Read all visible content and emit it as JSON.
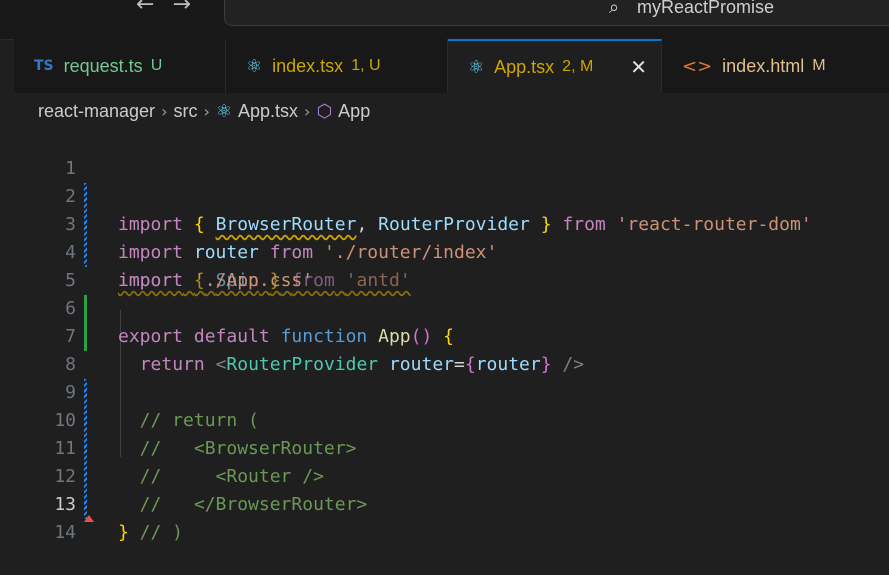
{
  "title_bar": {
    "back_icon": "arrow-left-icon",
    "forward_icon": "arrow-right-icon",
    "search_icon": "search-icon",
    "window_title": "myReactPromise"
  },
  "tabs": [
    {
      "label": "request.ts",
      "status": "U",
      "icon": "ts",
      "color": "#73c991",
      "active": false
    },
    {
      "label": "index.tsx",
      "status": "1, U",
      "icon": "react-icon",
      "color": "#cca700",
      "active": false
    },
    {
      "label": "App.tsx",
      "status": "2, M",
      "icon": "react-icon",
      "color": "#cca700",
      "active": true
    },
    {
      "label": "index.html",
      "status": "M",
      "icon": "html-icon",
      "color": "#e2c08d",
      "active": false
    }
  ],
  "breadcrumb": {
    "items": [
      "react-manager",
      "src",
      "App.tsx",
      "App"
    ]
  },
  "editor": {
    "line_numbers": [
      "1",
      "2",
      "3",
      "4",
      "5",
      "6",
      "7",
      "8",
      "9",
      "10",
      "11",
      "12",
      "13",
      "14"
    ],
    "current_line": "13",
    "tokens": {
      "l1": [
        "import",
        " ",
        "{",
        " ",
        "BrowserRouter",
        ", ",
        "RouterProvider",
        " ",
        "}",
        " ",
        "from",
        " ",
        "'react-router-dom'"
      ],
      "l2": [
        "import",
        " ",
        "router",
        " ",
        "from",
        " ",
        "'./router/index'"
      ],
      "l3": [
        "import",
        " ",
        "{",
        " ",
        "Spin",
        " ",
        "}",
        " ",
        "from",
        " ",
        "'antd'"
      ],
      "l4": [
        "import",
        " ",
        "'./App.css'"
      ],
      "l5": [
        "export",
        " ",
        "default",
        " ",
        "function",
        " ",
        "App",
        "()",
        " ",
        "{"
      ],
      "l6": [
        "  ",
        "return",
        " ",
        "<",
        "RouterProvider",
        " ",
        "router",
        "=",
        "{",
        "router",
        "}",
        " ",
        "/>"
      ],
      "l8": "  // return (",
      "l9": "  //   <BrowserRouter>",
      "l10": "  //     <Router />",
      "l11": "  //   </BrowserRouter>",
      "l12": "  // )",
      "l13": "}"
    }
  },
  "colors": {
    "git_modified": "#2188ff",
    "git_added": "#2ea043",
    "accent": "#0078d4"
  }
}
